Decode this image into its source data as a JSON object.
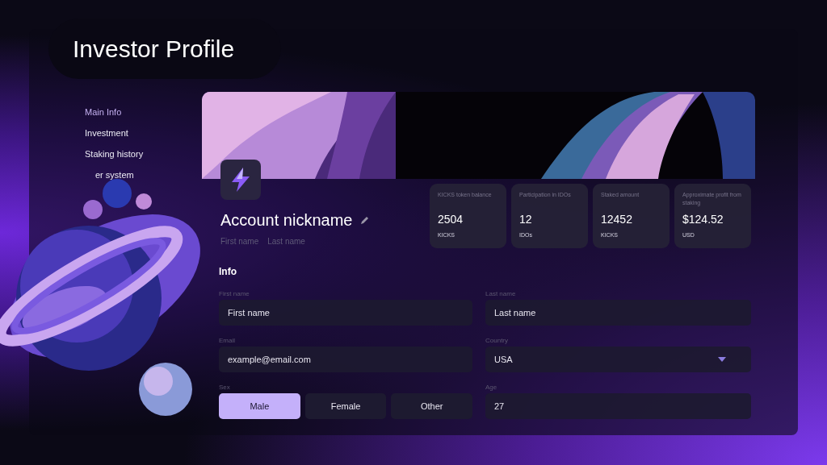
{
  "title": "Investor Profile",
  "sidebar": {
    "items": [
      {
        "label": "Main Info",
        "selected": true
      },
      {
        "label": "Investment",
        "selected": false
      },
      {
        "label": "Staking history",
        "selected": false
      },
      {
        "label": "er system",
        "selected": false
      }
    ]
  },
  "profile": {
    "nickname": "Account nickname",
    "first_name": "First name",
    "last_name": "Last name"
  },
  "stats": [
    {
      "label": "KICKS token balance",
      "value": "2504",
      "unit": "KICKS"
    },
    {
      "label": "Participation in IDOs",
      "value": "12",
      "unit": "IDOs"
    },
    {
      "label": "Staked amount",
      "value": "12452",
      "unit": "KICKS"
    },
    {
      "label": "Approximate profit from staking",
      "value": "$124.52",
      "unit": "USD"
    }
  ],
  "info": {
    "heading": "Info",
    "first_name": {
      "label": "First name",
      "value": "First name"
    },
    "last_name": {
      "label": "Last name",
      "value": "Last name"
    },
    "email": {
      "label": "Email",
      "value": "example@email.com"
    },
    "country": {
      "label": "Country",
      "value": "USA"
    },
    "sex": {
      "label": "Sex",
      "options": [
        {
          "label": "Male",
          "selected": true
        },
        {
          "label": "Female",
          "selected": false
        },
        {
          "label": "Other",
          "selected": false
        }
      ]
    },
    "age": {
      "label": "Age",
      "value": "27"
    }
  }
}
